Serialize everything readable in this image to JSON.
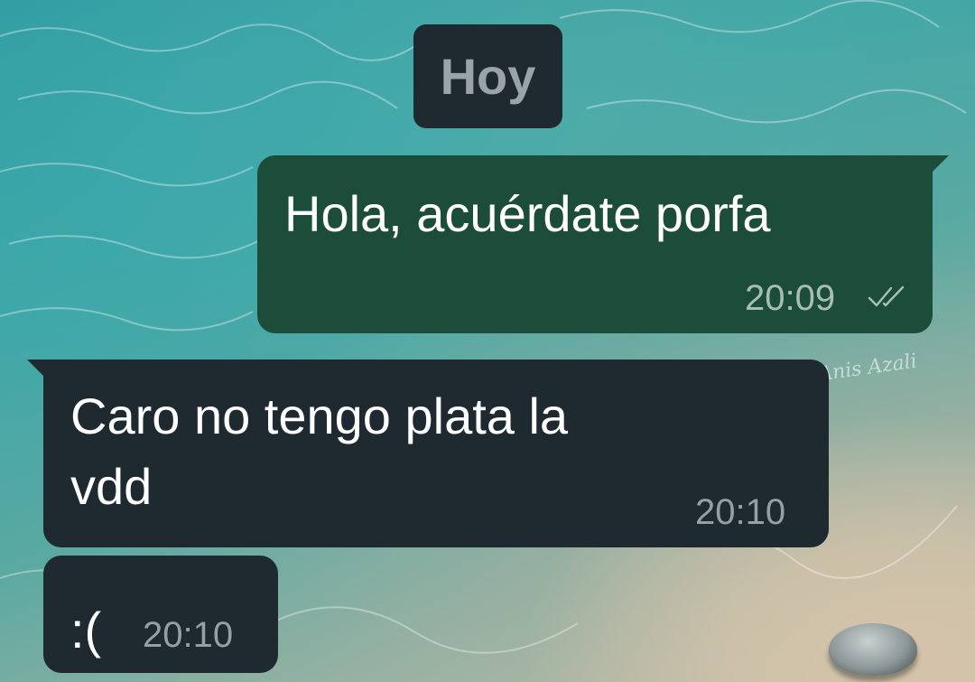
{
  "chat": {
    "date_label": "Hoy",
    "watermark": "Anis Azali",
    "messages": [
      {
        "direction": "outgoing",
        "text": "Hola, acuérdate porfa",
        "time": "20:09",
        "status_icon": "double-check-icon"
      },
      {
        "direction": "incoming",
        "text": "Caro no tengo plata la\nvdd",
        "time": "20:10"
      },
      {
        "direction": "incoming",
        "text": ":(",
        "time": "20:10"
      }
    ]
  },
  "colors": {
    "outgoing_bubble": "#1b4d3a",
    "incoming_bubble": "#1e2930",
    "date_chip": "#1e2a30",
    "timestamp": "#94a0a6"
  }
}
